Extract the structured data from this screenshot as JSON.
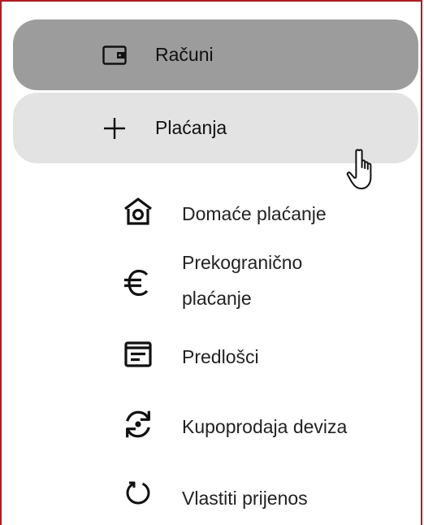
{
  "nav": {
    "items": [
      {
        "label": "Računi",
        "icon": "wallet-icon",
        "state": "active"
      },
      {
        "label": "Plaćanja",
        "icon": "plus-icon",
        "state": "hover"
      }
    ]
  },
  "submenu": {
    "items": [
      {
        "label": "Domaće plaćanje",
        "icon": "home-payment-icon"
      },
      {
        "label": "Prekogranično plaćanje",
        "label_line1": "Prekogranično",
        "label_line2": "plaćanje",
        "icon": "euro-icon"
      },
      {
        "label": "Predlošci",
        "icon": "template-icon"
      },
      {
        "label": "Kupoprodaja deviza",
        "icon": "currency-exchange-icon"
      },
      {
        "label": "Vlastiti prijenos",
        "icon": "transfer-circle-icon"
      }
    ]
  },
  "colors": {
    "active_bg": "#9c9c9c",
    "hover_bg": "#e3e3e3",
    "frame_border": "#b01c22"
  }
}
